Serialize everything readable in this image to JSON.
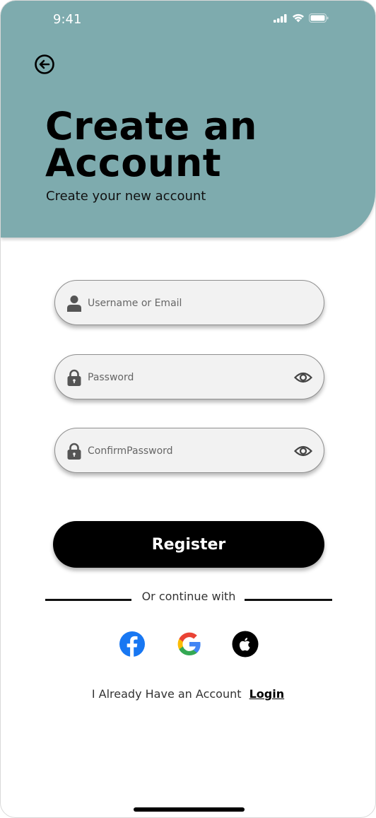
{
  "status_bar": {
    "time": "9:41"
  },
  "header": {
    "title_line1": "Create an",
    "title_line2": "Account",
    "subtitle": "Create your new account"
  },
  "form": {
    "username_placeholder": "Username or Email",
    "password_placeholder": "Password",
    "confirm_placeholder": "ConfirmPassword",
    "register_label": "Register"
  },
  "social": {
    "divider_text": "Or continue with",
    "providers": [
      "facebook-icon",
      "google-icon",
      "apple-icon"
    ]
  },
  "footer": {
    "prompt": "I Already Have an Account",
    "login_label": "Login"
  },
  "colors": {
    "header_bg": "#7eabae",
    "button_bg": "#000000",
    "field_bg": "#f2f2f2",
    "facebook": "#1877f2"
  }
}
